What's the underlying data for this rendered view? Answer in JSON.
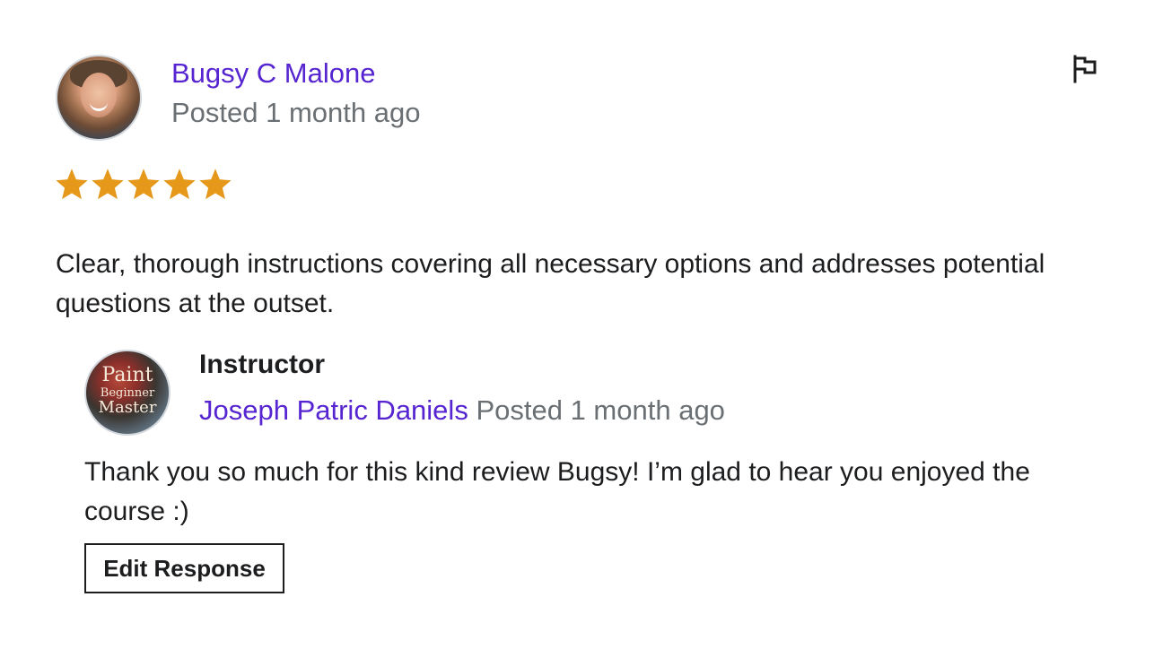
{
  "review": {
    "reviewer_name": "Bugsy C Malone",
    "posted": "Posted 1 month ago",
    "rating": 5,
    "rating_max": 5,
    "text": "Clear, thorough instructions covering all necessary options and addresses potential questions at the outset.",
    "flag_icon": "flag-icon"
  },
  "response": {
    "label": "Instructor",
    "instructor_name": "Joseph Patric Daniels",
    "posted": "Posted 1 month ago",
    "avatar_text": [
      "Paint",
      "Beginner",
      "Master"
    ],
    "text": "Thank you so much for this kind review Bugsy! I’m glad to hear you enjoyed the course :)",
    "edit_button_label": "Edit Response"
  },
  "colors": {
    "link_purple": "#5624d0",
    "muted_gray": "#6a6f73",
    "text_dark": "#1c1d1f",
    "star_gold": "#e59819"
  }
}
